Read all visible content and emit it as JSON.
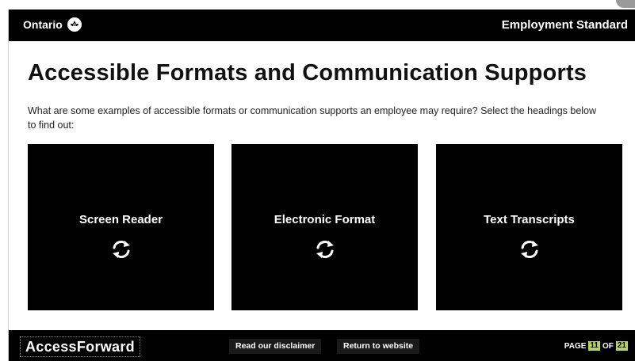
{
  "header": {
    "brand": "Ontario",
    "title": "Employment Standard"
  },
  "main": {
    "title": "Accessible Formats and Communication Supports",
    "intro": "What are some examples of accessible formats or communication supports an employee may require? Select the headings below to find out:",
    "cards": [
      {
        "label": "Screen Reader",
        "icon": "refresh-icon"
      },
      {
        "label": "Electronic Format",
        "icon": "refresh-icon"
      },
      {
        "label": "Text Transcripts",
        "icon": "refresh-icon"
      }
    ]
  },
  "footer": {
    "logo": "AccessForward",
    "disclaimer_label": "Read our disclaimer",
    "return_label": "Return to website",
    "page_prefix": "PAGE",
    "page_current": "11",
    "page_of": "OF",
    "page_total": "21"
  },
  "colors": {
    "header_bg": "#000000",
    "card_bg": "#000000",
    "page_badge": "#b6d35b"
  }
}
